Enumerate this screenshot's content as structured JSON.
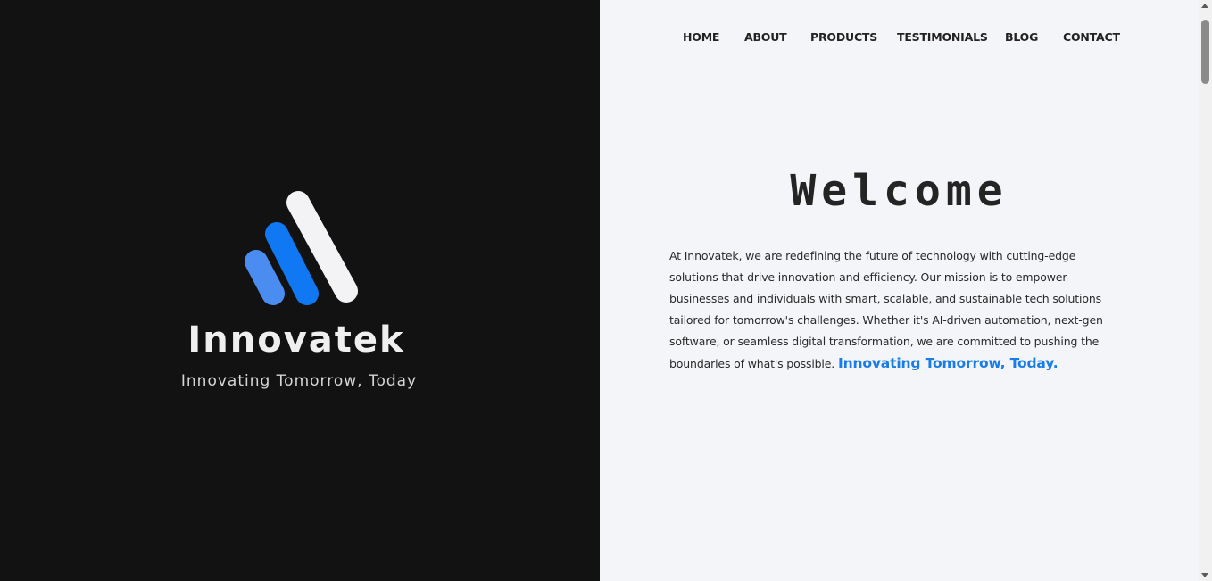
{
  "brand": {
    "name": "Innovatek",
    "tagline": "Innovating Tomorrow, Today",
    "colors": {
      "light_blue": "#4a8cf0",
      "blue": "#0f78f2",
      "white": "#f3f3f5"
    }
  },
  "nav": {
    "items": [
      {
        "label": "HOME"
      },
      {
        "label": "ABOUT"
      },
      {
        "label": "PRODUCTS"
      },
      {
        "label": "TESTIMONIALS"
      },
      {
        "label": "BLOG"
      },
      {
        "label": "CONTACT"
      }
    ]
  },
  "hero": {
    "title": "Welcome",
    "body": "At Innovatek, we are redefining the future of technology with cutting-edge solutions that drive innovation and efficiency. Our mission is to empower businesses and individuals with smart, scalable, and sustainable tech solutions tailored for tomorrow's challenges. Whether it's AI-driven automation, next-gen software, or seamless digital transformation, we are committed to pushing the boundaries of what's possible.",
    "highlight": "Innovating Tomorrow, Today.",
    "highlight_color": "#1a7ce6"
  }
}
